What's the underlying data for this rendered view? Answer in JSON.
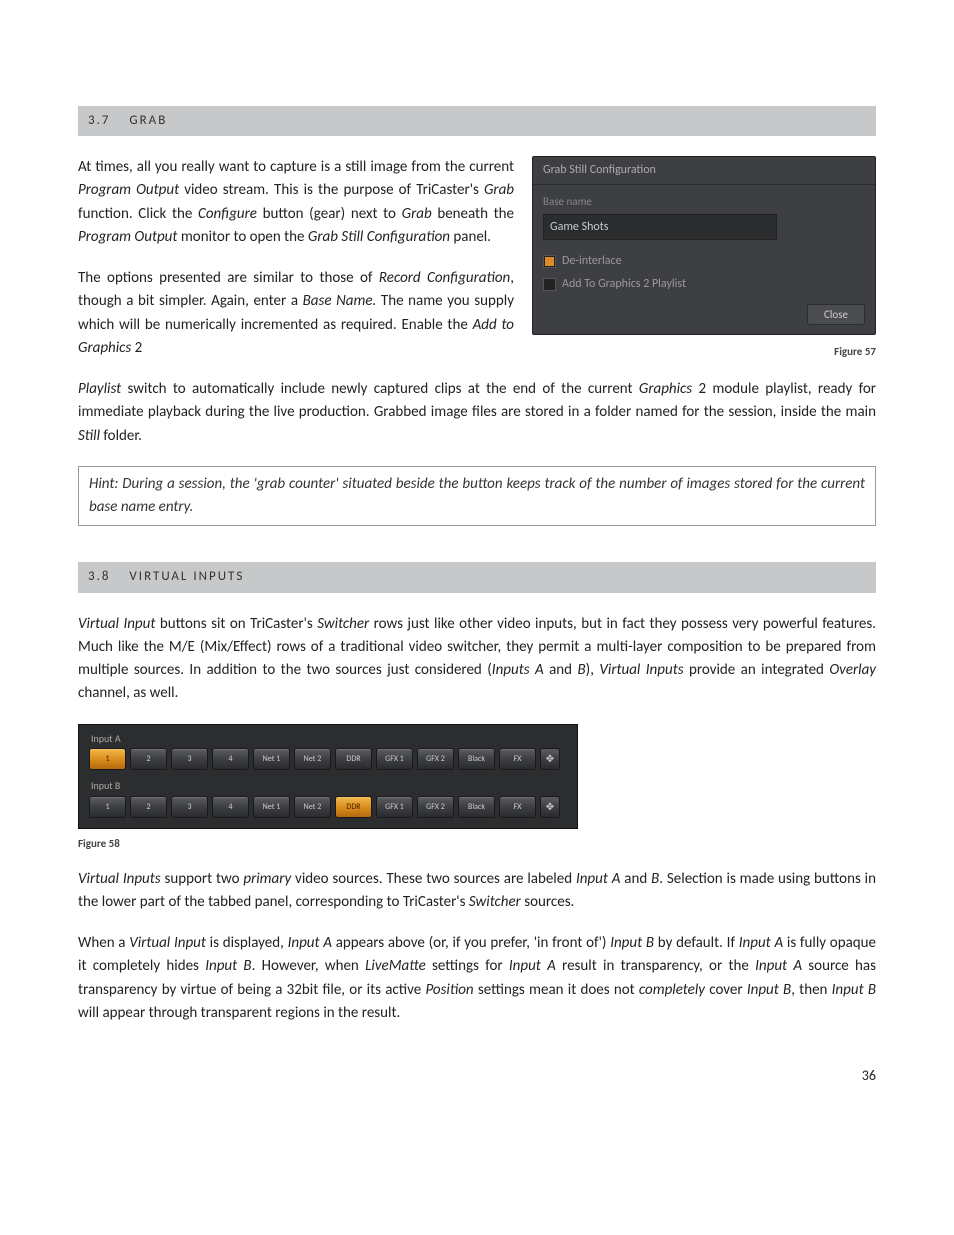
{
  "sections": {
    "grab": {
      "num": "3.7",
      "title": "GRAB"
    },
    "virtual": {
      "num": "3.8",
      "title": "VIRTUAL INPUTS"
    }
  },
  "para": {
    "g1a": "At times, all you really want to capture is a still image from the current ",
    "g1b": "Program Output",
    "g1c": " video stream.  This is the purpose of TriCaster's ",
    "g1d": "Grab",
    "g1e": " function.  Click the ",
    "g1f": "Configure",
    "g1g": " button (gear) next to ",
    "g1h": "Grab",
    "g1i": " beneath the ",
    "g1j": "Program Output",
    "g1k": " monitor to open the ",
    "g1l": "Grab Still Configuration",
    "g1m": " panel.",
    "g2a": "The options presented are similar to those of ",
    "g2b": "Record Configuration",
    "g2c": ", though a bit simpler.  Again, enter a ",
    "g2d": "Base Name.",
    "g2e": " The name you supply which will be numerically incremented as required.  Enable the ",
    "g2f": "Add to Graphics",
    "g2g": " 2 ",
    "g3a": "Playlist",
    "g3b": " switch to automatically include newly captured clips at the end of the current ",
    "g3c": "Graphics",
    "g3d": " 2 module playlist, ready for immediate playback during the live production. Grabbed image files are stored in a folder named for the session, inside the main ",
    "g3e": "Still",
    "g3f": " folder.",
    "hint": "Hint: During a session, the 'grab counter' situated beside the button keeps track of the number of images stored for the current base name entry.",
    "v1a": "Virtual Input",
    "v1b": " buttons sit on TriCaster's ",
    "v1c": "Switcher",
    "v1d": " rows just like other video inputs, but in fact they possess very powerful features.  Much like the M/E (Mix/Effect) rows of a traditional video switcher, they permit a multi-layer composition to be prepared from multiple sources. In addition to the two sources just considered (",
    "v1e": "Inputs A",
    "v1f": " and ",
    "v1g": "B",
    "v1h": "), ",
    "v1i": "Virtual Inputs",
    "v1j": " provide an integrated ",
    "v1k": "Overlay",
    "v1l": " channel, as well.",
    "v2a": "Virtual Inputs",
    "v2b": " support two ",
    "v2c": "primary",
    "v2d": " video sources. These two sources are labeled ",
    "v2e": "Input A",
    "v2f": " and ",
    "v2g": "B",
    "v2h": ".  Selection is made using buttons in the lower part of the tabbed panel, corresponding to TriCaster's ",
    "v2i": "Switcher",
    "v2j": " sources.",
    "v3a": "When a ",
    "v3b": "Virtual Input",
    "v3c": " is displayed, ",
    "v3d": "Input A",
    "v3e": " appears above (or, if you prefer, 'in front of') ",
    "v3f": "Input B",
    "v3g": " by default.  If ",
    "v3h": "Input A",
    "v3i": " is fully opaque it completely hides ",
    "v3j": "Input B",
    "v3k": ".  However, when ",
    "v3l": "LiveMatte",
    "v3m": " settings for ",
    "v3n": "Input A",
    "v3o": " result in transparency, or the ",
    "v3p": "Input A",
    "v3q": " source has transparency by virtue of being a 32bit file, or its active ",
    "v3r": "Position",
    "v3s": " settings mean it does not ",
    "v3t": "completely",
    "v3u": " cover ",
    "v3v": "Input B",
    "v3w": ", then ",
    "v3x": "Input B",
    "v3y": " will appear through transparent regions in the result."
  },
  "grab_panel": {
    "title": "Grab Still Configuration",
    "base_name_label": "Base name",
    "base_name_value": "Game Shots",
    "deinterlace": "De-interlace",
    "add_playlist": "Add To Graphics 2 Playlist",
    "close": "Close"
  },
  "captions": {
    "fig57": "Figure 57",
    "fig58": "Figure 58"
  },
  "switcher": {
    "rowA": "Input A",
    "rowB": "Input B",
    "btns": [
      "1",
      "2",
      "3",
      "4",
      "Net 1",
      "Net 2",
      "DDR",
      "GFX 1",
      "GFX 2",
      "Black",
      "FX"
    ],
    "selectedA": "1",
    "selectedB": "DDR",
    "move_icon": "✥"
  },
  "page_number": "36"
}
